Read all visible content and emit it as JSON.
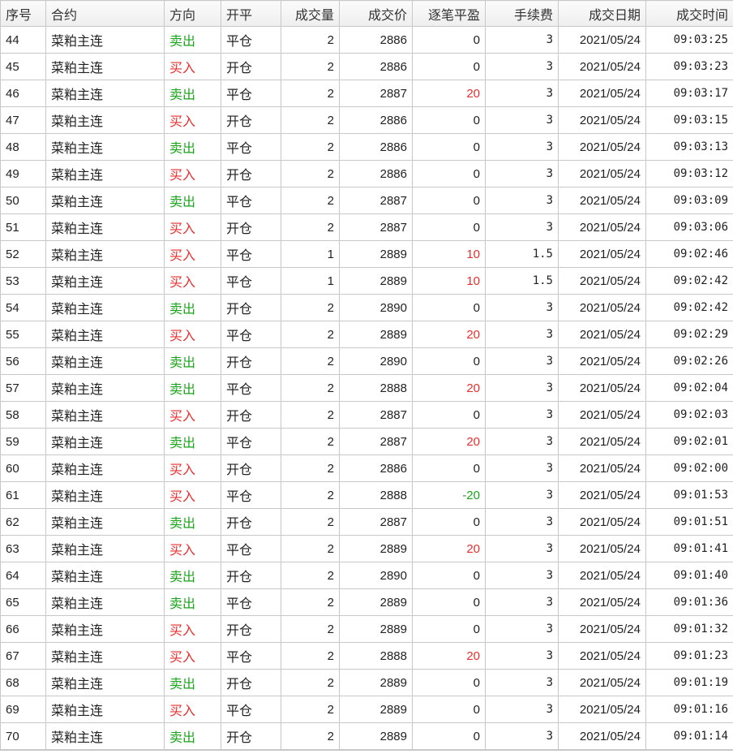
{
  "colors": {
    "buy": "#ea2e2e",
    "sell": "#1aa61a",
    "profit_positive": "#ea2e2e",
    "profit_negative": "#1aa61a"
  },
  "table": {
    "headers": [
      "序号",
      "合约",
      "方向",
      "开平",
      "成交量",
      "成交价",
      "逐笔平盈",
      "手续费",
      "成交日期",
      "成交时间"
    ],
    "rows": [
      {
        "no": "44",
        "contract": "菜粕主连",
        "dir": "卖出",
        "oc": "平仓",
        "vol": "2",
        "price": "2886",
        "pnl": "0",
        "fee": "3",
        "date": "2021/05/24",
        "time": "09:03:25"
      },
      {
        "no": "45",
        "contract": "菜粕主连",
        "dir": "买入",
        "oc": "开仓",
        "vol": "2",
        "price": "2886",
        "pnl": "0",
        "fee": "3",
        "date": "2021/05/24",
        "time": "09:03:23"
      },
      {
        "no": "46",
        "contract": "菜粕主连",
        "dir": "卖出",
        "oc": "平仓",
        "vol": "2",
        "price": "2887",
        "pnl": "20",
        "fee": "3",
        "date": "2021/05/24",
        "time": "09:03:17"
      },
      {
        "no": "47",
        "contract": "菜粕主连",
        "dir": "买入",
        "oc": "开仓",
        "vol": "2",
        "price": "2886",
        "pnl": "0",
        "fee": "3",
        "date": "2021/05/24",
        "time": "09:03:15"
      },
      {
        "no": "48",
        "contract": "菜粕主连",
        "dir": "卖出",
        "oc": "平仓",
        "vol": "2",
        "price": "2886",
        "pnl": "0",
        "fee": "3",
        "date": "2021/05/24",
        "time": "09:03:13"
      },
      {
        "no": "49",
        "contract": "菜粕主连",
        "dir": "买入",
        "oc": "开仓",
        "vol": "2",
        "price": "2886",
        "pnl": "0",
        "fee": "3",
        "date": "2021/05/24",
        "time": "09:03:12"
      },
      {
        "no": "50",
        "contract": "菜粕主连",
        "dir": "卖出",
        "oc": "平仓",
        "vol": "2",
        "price": "2887",
        "pnl": "0",
        "fee": "3",
        "date": "2021/05/24",
        "time": "09:03:09"
      },
      {
        "no": "51",
        "contract": "菜粕主连",
        "dir": "买入",
        "oc": "开仓",
        "vol": "2",
        "price": "2887",
        "pnl": "0",
        "fee": "3",
        "date": "2021/05/24",
        "time": "09:03:06"
      },
      {
        "no": "52",
        "contract": "菜粕主连",
        "dir": "买入",
        "oc": "平仓",
        "vol": "1",
        "price": "2889",
        "pnl": "10",
        "fee": "1.5",
        "date": "2021/05/24",
        "time": "09:02:46"
      },
      {
        "no": "53",
        "contract": "菜粕主连",
        "dir": "买入",
        "oc": "平仓",
        "vol": "1",
        "price": "2889",
        "pnl": "10",
        "fee": "1.5",
        "date": "2021/05/24",
        "time": "09:02:42"
      },
      {
        "no": "54",
        "contract": "菜粕主连",
        "dir": "卖出",
        "oc": "开仓",
        "vol": "2",
        "price": "2890",
        "pnl": "0",
        "fee": "3",
        "date": "2021/05/24",
        "time": "09:02:42"
      },
      {
        "no": "55",
        "contract": "菜粕主连",
        "dir": "买入",
        "oc": "平仓",
        "vol": "2",
        "price": "2889",
        "pnl": "20",
        "fee": "3",
        "date": "2021/05/24",
        "time": "09:02:29"
      },
      {
        "no": "56",
        "contract": "菜粕主连",
        "dir": "卖出",
        "oc": "开仓",
        "vol": "2",
        "price": "2890",
        "pnl": "0",
        "fee": "3",
        "date": "2021/05/24",
        "time": "09:02:26"
      },
      {
        "no": "57",
        "contract": "菜粕主连",
        "dir": "卖出",
        "oc": "平仓",
        "vol": "2",
        "price": "2888",
        "pnl": "20",
        "fee": "3",
        "date": "2021/05/24",
        "time": "09:02:04"
      },
      {
        "no": "58",
        "contract": "菜粕主连",
        "dir": "买入",
        "oc": "开仓",
        "vol": "2",
        "price": "2887",
        "pnl": "0",
        "fee": "3",
        "date": "2021/05/24",
        "time": "09:02:03"
      },
      {
        "no": "59",
        "contract": "菜粕主连",
        "dir": "卖出",
        "oc": "平仓",
        "vol": "2",
        "price": "2887",
        "pnl": "20",
        "fee": "3",
        "date": "2021/05/24",
        "time": "09:02:01"
      },
      {
        "no": "60",
        "contract": "菜粕主连",
        "dir": "买入",
        "oc": "开仓",
        "vol": "2",
        "price": "2886",
        "pnl": "0",
        "fee": "3",
        "date": "2021/05/24",
        "time": "09:02:00"
      },
      {
        "no": "61",
        "contract": "菜粕主连",
        "dir": "买入",
        "oc": "平仓",
        "vol": "2",
        "price": "2888",
        "pnl": "-20",
        "fee": "3",
        "date": "2021/05/24",
        "time": "09:01:53"
      },
      {
        "no": "62",
        "contract": "菜粕主连",
        "dir": "卖出",
        "oc": "开仓",
        "vol": "2",
        "price": "2887",
        "pnl": "0",
        "fee": "3",
        "date": "2021/05/24",
        "time": "09:01:51"
      },
      {
        "no": "63",
        "contract": "菜粕主连",
        "dir": "买入",
        "oc": "平仓",
        "vol": "2",
        "price": "2889",
        "pnl": "20",
        "fee": "3",
        "date": "2021/05/24",
        "time": "09:01:41"
      },
      {
        "no": "64",
        "contract": "菜粕主连",
        "dir": "卖出",
        "oc": "开仓",
        "vol": "2",
        "price": "2890",
        "pnl": "0",
        "fee": "3",
        "date": "2021/05/24",
        "time": "09:01:40"
      },
      {
        "no": "65",
        "contract": "菜粕主连",
        "dir": "卖出",
        "oc": "平仓",
        "vol": "2",
        "price": "2889",
        "pnl": "0",
        "fee": "3",
        "date": "2021/05/24",
        "time": "09:01:36"
      },
      {
        "no": "66",
        "contract": "菜粕主连",
        "dir": "买入",
        "oc": "开仓",
        "vol": "2",
        "price": "2889",
        "pnl": "0",
        "fee": "3",
        "date": "2021/05/24",
        "time": "09:01:32"
      },
      {
        "no": "67",
        "contract": "菜粕主连",
        "dir": "买入",
        "oc": "平仓",
        "vol": "2",
        "price": "2888",
        "pnl": "20",
        "fee": "3",
        "date": "2021/05/24",
        "time": "09:01:23"
      },
      {
        "no": "68",
        "contract": "菜粕主连",
        "dir": "卖出",
        "oc": "开仓",
        "vol": "2",
        "price": "2889",
        "pnl": "0",
        "fee": "3",
        "date": "2021/05/24",
        "time": "09:01:19"
      },
      {
        "no": "69",
        "contract": "菜粕主连",
        "dir": "买入",
        "oc": "平仓",
        "vol": "2",
        "price": "2889",
        "pnl": "0",
        "fee": "3",
        "date": "2021/05/24",
        "time": "09:01:16"
      },
      {
        "no": "70",
        "contract": "菜粕主连",
        "dir": "卖出",
        "oc": "开仓",
        "vol": "2",
        "price": "2889",
        "pnl": "0",
        "fee": "3",
        "date": "2021/05/24",
        "time": "09:01:14"
      }
    ]
  }
}
